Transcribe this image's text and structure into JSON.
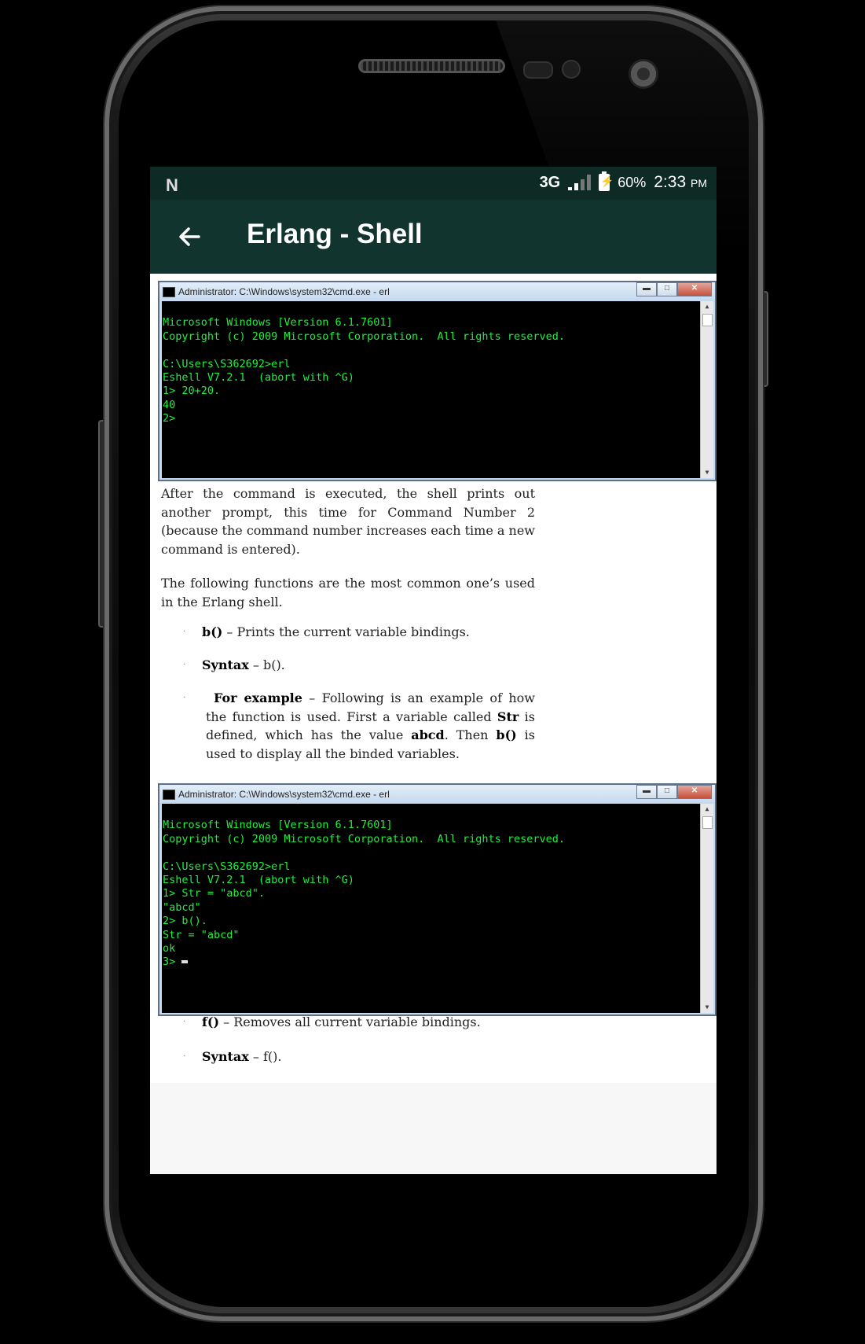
{
  "status_bar": {
    "logo": "N",
    "network": "3G",
    "battery_percent": "60%",
    "time": "2:33",
    "time_suffix": "PM"
  },
  "app_bar": {
    "title": "Erlang - Shell",
    "back_icon": "arrow-left-icon"
  },
  "cmd1": {
    "title": "Administrator: C:\\Windows\\system32\\cmd.exe - erl",
    "lines": [
      "Microsoft Windows [Version 6.1.7601]",
      "Copyright (c) 2009 Microsoft Corporation.  All rights reserved.",
      "",
      "C:\\Users\\S362692>erl",
      "Eshell V7.2.1  (abort with ^G)",
      "1> 20+20.",
      "40",
      "2>"
    ]
  },
  "paragraphs": {
    "p1": "After the command is executed, the shell prints out another prompt, this time for Command Number 2 (because the command number increases each time a new command is entered).",
    "p2": "The following functions are the most common one’s used in the Erlang shell."
  },
  "bullets": {
    "b1_bold": "b()",
    "b1_text": " – Prints the current variable bindings.",
    "b2_bold": "Syntax",
    "b2_text": " – b().",
    "b3_bold": "For example",
    "b3_t1": " – Following is an example of how the function is used. First a variable called ",
    "b3_str": "Str",
    "b3_t2": " is defined, which has the value ",
    "b3_abcd": "abcd",
    "b3_t3": ". Then ",
    "b3_b": "b()",
    "b3_t4": " is used to display all the binded variables.",
    "b4_bold": "f()",
    "b4_text": " – Removes all current variable bindings.",
    "b5_bold": "Syntax",
    "b5_text": " – f()."
  },
  "cmd2": {
    "title": "Administrator: C:\\Windows\\system32\\cmd.exe - erl",
    "lines": [
      "Microsoft Windows [Version 6.1.7601]",
      "Copyright (c) 2009 Microsoft Corporation.  All rights reserved.",
      "",
      "C:\\Users\\S362692>erl",
      "Eshell V7.2.1  (abort with ^G)",
      "1> Str = \"abcd\".",
      "\"abcd\"",
      "2> b().",
      "Str = \"abcd\"",
      "ok",
      "3> "
    ]
  },
  "colors": {
    "status_bar": "#0d2a24",
    "app_bar": "#11352e",
    "terminal_text": "#1ef03c"
  }
}
